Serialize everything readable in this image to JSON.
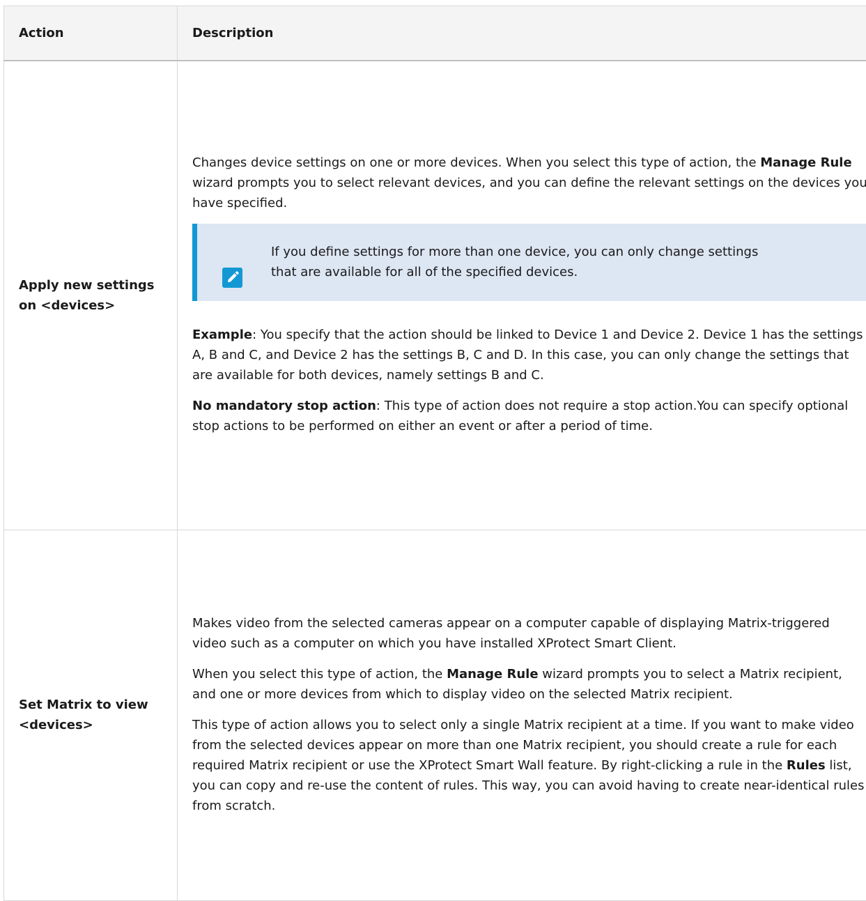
{
  "table": {
    "headers": {
      "action": "Action",
      "description": "Description"
    },
    "rows": [
      {
        "action": "Apply new settings on <devices>",
        "intro": {
          "pre": "Changes device settings on one or more devices. When you select this type of action, the ",
          "bold": "Manage Rule",
          "post": " wizard prompts you to select relevant devices, and you can define the relevant settings on the devices you have specified."
        },
        "note": {
          "icon": "pencil-icon",
          "text": "If you define settings for more than one device, you can only change settings that are available for all of the specified devices."
        },
        "example": {
          "label": "Example",
          "text": ": You specify that the action should be linked to Device 1 and Device 2. Device 1 has the settings A, B and C, and Device 2 has the settings B, C and D. In this case, you can only change the settings that are available for both devices, namely settings B and C."
        },
        "stop": {
          "label": "No mandatory stop action",
          "text": ": This type of action does not require a stop action.You can specify optional stop actions to be performed on either an event or after a period of time."
        }
      },
      {
        "action": "Set Matrix to view <devices>",
        "para1": "Makes video from the selected cameras appear on a computer capable of displaying Matrix-triggered video such as a computer on which you have installed XProtect Smart Client.",
        "para2": {
          "pre": "When you select this type of action, the ",
          "bold": "Manage Rule",
          "post": " wizard prompts you to select a Matrix recipient, and one or more devices from which to display video on the selected Matrix recipient."
        },
        "para3": {
          "pre": "This type of action allows you to select only a single Matrix recipient at a time. If you want to make video from the selected devices appear on more than one Matrix recipient, you should create a rule for each required Matrix recipient or use the XProtect Smart Wall feature. By right-clicking a rule in the ",
          "bold": "Rules",
          "post": " list, you can copy and re-use the content of rules. This way, you can avoid having to create near-identical rules from scratch."
        }
      }
    ]
  },
  "colors": {
    "note_background": "#dde6f3",
    "note_accent": "#1398d4",
    "header_background": "#f4f4f4"
  }
}
